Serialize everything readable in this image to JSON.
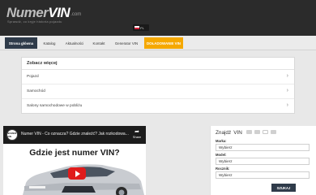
{
  "header": {
    "logo_primary": "Numer",
    "logo_accent": "VIN",
    "logo_suffix": ".com",
    "logo_tagline": "Sprawdź, co kryje historia pojazdu",
    "language_code": "PL"
  },
  "nav": {
    "items": [
      {
        "label": "Strona główna"
      },
      {
        "label": "Katalog"
      },
      {
        "label": "Aktualności"
      },
      {
        "label": "Kontakt"
      },
      {
        "label": "Generator VIN"
      },
      {
        "label": "DOŁADOWANIE VIN"
      }
    ]
  },
  "see_more": {
    "title": "Zobacz więcej",
    "items": [
      {
        "label": "Pojazd"
      },
      {
        "label": "Samochód"
      },
      {
        "label": "Salony samochodowe w pobliżu"
      }
    ]
  },
  "video": {
    "channel": "NUMER VIN",
    "title": "Numer VIN - Co oznacza? Gdzie znaleźć? Jak rozkodowa...",
    "share_label": "Share",
    "headline": "Gdzie jest numer VIN?"
  },
  "search_panel": {
    "title_prefix": "Znajdź",
    "title_accent": "VIN",
    "fields": [
      {
        "label": "Marka:",
        "value": "Wybierz"
      },
      {
        "label": "Model:",
        "value": "Wybierz"
      },
      {
        "label": "Rocznik:",
        "value": "Wybierz"
      }
    ],
    "button_label": "SZUKAJ"
  },
  "colors": {
    "header_bg": "#2b2b2b",
    "nav_active": "#2f3b4a",
    "nav_promo": "#f5a800",
    "play_red": "#e01b1b"
  }
}
